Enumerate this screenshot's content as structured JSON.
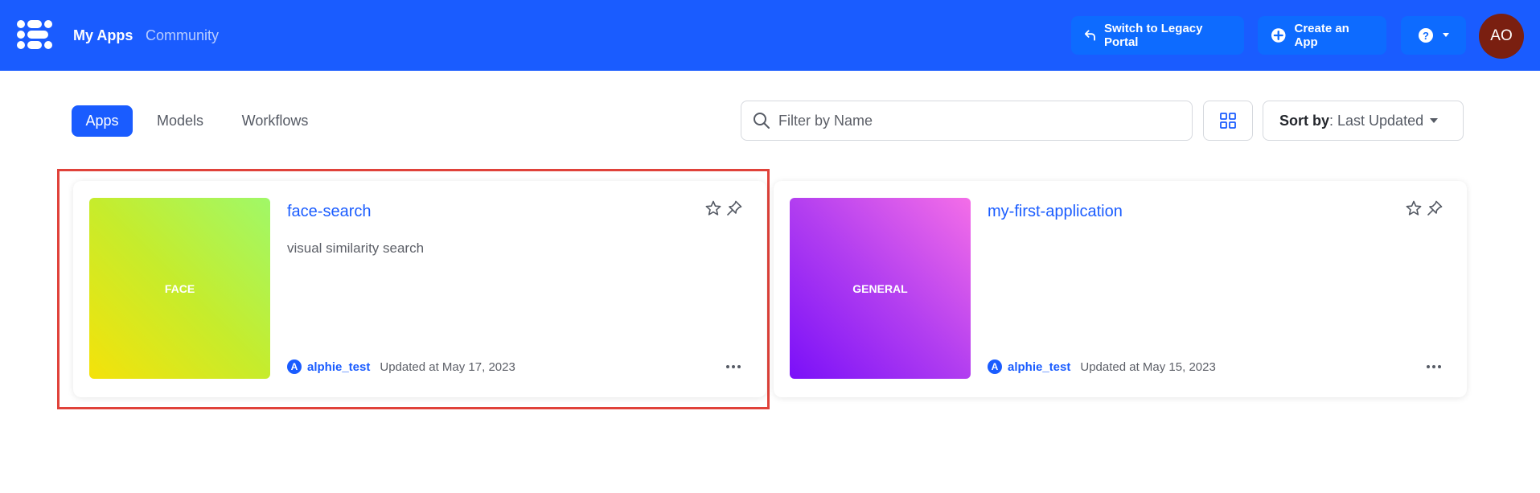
{
  "header": {
    "nav": {
      "my_apps": "My Apps",
      "community": "Community"
    },
    "legacy_button": "Switch to Legacy Portal",
    "create_button": "Create an App",
    "avatar_initials": "AO",
    "brand_color": "#1a5cff"
  },
  "tabs": [
    "Apps",
    "Models",
    "Workflows"
  ],
  "search": {
    "placeholder": "Filter by Name"
  },
  "sort": {
    "label": "Sort by",
    "value": ": Last Updated"
  },
  "apps": [
    {
      "title": "face-search",
      "description": "visual similarity search",
      "thumb_label": "FACE",
      "owner": "alphie_test",
      "owner_initial": "A",
      "updated": "Updated at May 17, 2023"
    },
    {
      "title": "my-first-application",
      "description": "",
      "thumb_label": "GENERAL",
      "owner": "alphie_test",
      "owner_initial": "A",
      "updated": "Updated at May 15, 2023"
    }
  ]
}
